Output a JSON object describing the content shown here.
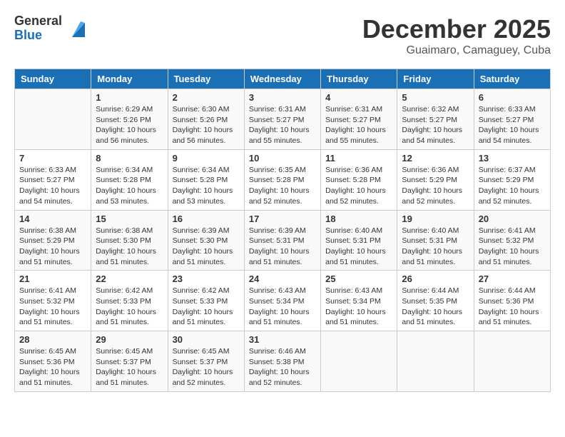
{
  "logo": {
    "general": "General",
    "blue": "Blue"
  },
  "header": {
    "month": "December 2025",
    "location": "Guaimaro, Camaguey, Cuba"
  },
  "weekdays": [
    "Sunday",
    "Monday",
    "Tuesday",
    "Wednesday",
    "Thursday",
    "Friday",
    "Saturday"
  ],
  "weeks": [
    [
      {
        "day": "",
        "info": ""
      },
      {
        "day": "1",
        "info": "Sunrise: 6:29 AM\nSunset: 5:26 PM\nDaylight: 10 hours\nand 56 minutes."
      },
      {
        "day": "2",
        "info": "Sunrise: 6:30 AM\nSunset: 5:26 PM\nDaylight: 10 hours\nand 56 minutes."
      },
      {
        "day": "3",
        "info": "Sunrise: 6:31 AM\nSunset: 5:27 PM\nDaylight: 10 hours\nand 55 minutes."
      },
      {
        "day": "4",
        "info": "Sunrise: 6:31 AM\nSunset: 5:27 PM\nDaylight: 10 hours\nand 55 minutes."
      },
      {
        "day": "5",
        "info": "Sunrise: 6:32 AM\nSunset: 5:27 PM\nDaylight: 10 hours\nand 54 minutes."
      },
      {
        "day": "6",
        "info": "Sunrise: 6:33 AM\nSunset: 5:27 PM\nDaylight: 10 hours\nand 54 minutes."
      }
    ],
    [
      {
        "day": "7",
        "info": "Sunrise: 6:33 AM\nSunset: 5:27 PM\nDaylight: 10 hours\nand 54 minutes."
      },
      {
        "day": "8",
        "info": "Sunrise: 6:34 AM\nSunset: 5:28 PM\nDaylight: 10 hours\nand 53 minutes."
      },
      {
        "day": "9",
        "info": "Sunrise: 6:34 AM\nSunset: 5:28 PM\nDaylight: 10 hours\nand 53 minutes."
      },
      {
        "day": "10",
        "info": "Sunrise: 6:35 AM\nSunset: 5:28 PM\nDaylight: 10 hours\nand 52 minutes."
      },
      {
        "day": "11",
        "info": "Sunrise: 6:36 AM\nSunset: 5:28 PM\nDaylight: 10 hours\nand 52 minutes."
      },
      {
        "day": "12",
        "info": "Sunrise: 6:36 AM\nSunset: 5:29 PM\nDaylight: 10 hours\nand 52 minutes."
      },
      {
        "day": "13",
        "info": "Sunrise: 6:37 AM\nSunset: 5:29 PM\nDaylight: 10 hours\nand 52 minutes."
      }
    ],
    [
      {
        "day": "14",
        "info": "Sunrise: 6:38 AM\nSunset: 5:29 PM\nDaylight: 10 hours\nand 51 minutes."
      },
      {
        "day": "15",
        "info": "Sunrise: 6:38 AM\nSunset: 5:30 PM\nDaylight: 10 hours\nand 51 minutes."
      },
      {
        "day": "16",
        "info": "Sunrise: 6:39 AM\nSunset: 5:30 PM\nDaylight: 10 hours\nand 51 minutes."
      },
      {
        "day": "17",
        "info": "Sunrise: 6:39 AM\nSunset: 5:31 PM\nDaylight: 10 hours\nand 51 minutes."
      },
      {
        "day": "18",
        "info": "Sunrise: 6:40 AM\nSunset: 5:31 PM\nDaylight: 10 hours\nand 51 minutes."
      },
      {
        "day": "19",
        "info": "Sunrise: 6:40 AM\nSunset: 5:31 PM\nDaylight: 10 hours\nand 51 minutes."
      },
      {
        "day": "20",
        "info": "Sunrise: 6:41 AM\nSunset: 5:32 PM\nDaylight: 10 hours\nand 51 minutes."
      }
    ],
    [
      {
        "day": "21",
        "info": "Sunrise: 6:41 AM\nSunset: 5:32 PM\nDaylight: 10 hours\nand 51 minutes."
      },
      {
        "day": "22",
        "info": "Sunrise: 6:42 AM\nSunset: 5:33 PM\nDaylight: 10 hours\nand 51 minutes."
      },
      {
        "day": "23",
        "info": "Sunrise: 6:42 AM\nSunset: 5:33 PM\nDaylight: 10 hours\nand 51 minutes."
      },
      {
        "day": "24",
        "info": "Sunrise: 6:43 AM\nSunset: 5:34 PM\nDaylight: 10 hours\nand 51 minutes."
      },
      {
        "day": "25",
        "info": "Sunrise: 6:43 AM\nSunset: 5:34 PM\nDaylight: 10 hours\nand 51 minutes."
      },
      {
        "day": "26",
        "info": "Sunrise: 6:44 AM\nSunset: 5:35 PM\nDaylight: 10 hours\nand 51 minutes."
      },
      {
        "day": "27",
        "info": "Sunrise: 6:44 AM\nSunset: 5:36 PM\nDaylight: 10 hours\nand 51 minutes."
      }
    ],
    [
      {
        "day": "28",
        "info": "Sunrise: 6:45 AM\nSunset: 5:36 PM\nDaylight: 10 hours\nand 51 minutes."
      },
      {
        "day": "29",
        "info": "Sunrise: 6:45 AM\nSunset: 5:37 PM\nDaylight: 10 hours\nand 51 minutes."
      },
      {
        "day": "30",
        "info": "Sunrise: 6:45 AM\nSunset: 5:37 PM\nDaylight: 10 hours\nand 52 minutes."
      },
      {
        "day": "31",
        "info": "Sunrise: 6:46 AM\nSunset: 5:38 PM\nDaylight: 10 hours\nand 52 minutes."
      },
      {
        "day": "",
        "info": ""
      },
      {
        "day": "",
        "info": ""
      },
      {
        "day": "",
        "info": ""
      }
    ]
  ]
}
